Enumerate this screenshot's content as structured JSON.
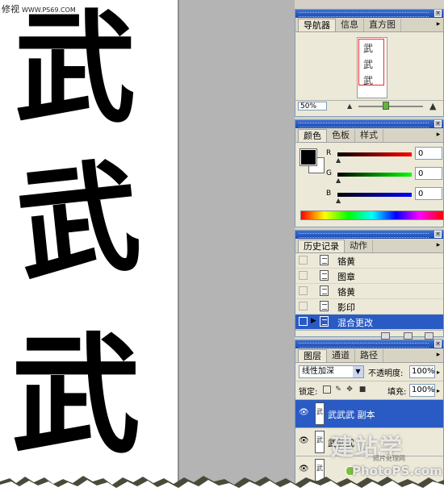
{
  "canvas": {
    "watermark_top": "修视",
    "watermark_top_url": "WWW.PS69.COM",
    "characters": [
      "武",
      "武",
      "武"
    ]
  },
  "navigator": {
    "tabs": [
      {
        "label": "导航器",
        "active": true
      },
      {
        "label": "信息",
        "active": false
      },
      {
        "label": "直方图",
        "active": false
      }
    ],
    "thumb_glyphs": [
      "武",
      "武",
      "武"
    ],
    "zoom": "50%"
  },
  "color": {
    "tabs": [
      {
        "label": "颜色",
        "active": true
      },
      {
        "label": "色板",
        "active": false
      },
      {
        "label": "样式",
        "active": false
      }
    ],
    "channels": [
      {
        "label": "R",
        "value": "0",
        "gradient_end": "#ff0000"
      },
      {
        "label": "G",
        "value": "0",
        "gradient_end": "#00ff00"
      },
      {
        "label": "B",
        "value": "0",
        "gradient_end": "#0000ff"
      }
    ],
    "foreground": "#000000",
    "background": "#ffffff"
  },
  "history": {
    "tabs": [
      {
        "label": "历史记录",
        "active": true
      },
      {
        "label": "动作",
        "active": false
      }
    ],
    "items": [
      {
        "label": "铬黄",
        "selected": false
      },
      {
        "label": "图章",
        "selected": false
      },
      {
        "label": "铬黄",
        "selected": false
      },
      {
        "label": "影印",
        "selected": false
      },
      {
        "label": "混合更改",
        "selected": true
      }
    ]
  },
  "layers": {
    "tabs": [
      {
        "label": "图层",
        "active": true
      },
      {
        "label": "通道",
        "active": false
      },
      {
        "label": "路径",
        "active": false
      }
    ],
    "blend_mode": "线性加深",
    "opacity_label": "不透明度:",
    "opacity": "100%",
    "lock_label": "锁定:",
    "fill_label": "填充:",
    "fill": "100%",
    "items": [
      {
        "label": "武武武 副本",
        "selected": true
      },
      {
        "label": "武武武",
        "selected": false
      },
      {
        "label": "",
        "selected": false
      }
    ]
  },
  "watermark_bottom": {
    "big": "建站学",
    "small": "照片处理网",
    "url": "PhotoPS.com"
  },
  "colors": {
    "panel_bg": "#ece9d8",
    "titlebar": "#2a5bc4",
    "selection": "#2a5bc4"
  }
}
